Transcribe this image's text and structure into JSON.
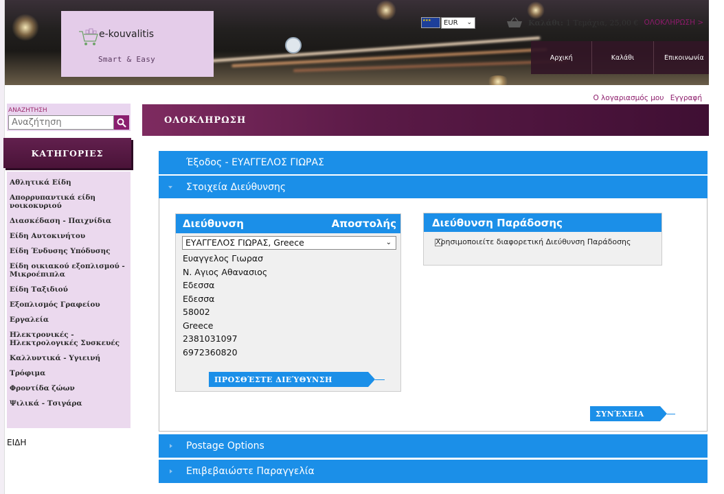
{
  "logo": {
    "name": "e-kouvalitis",
    "tagline": "Smart & Easy"
  },
  "currency": {
    "selected": "EUR"
  },
  "topbar": {
    "cart_label": "Καλάθι:",
    "cart_summary": "1 Τεμάχια, 25,00 €",
    "checkout_link": "ΟΛΟΚΛΗΡΩΣΗ >"
  },
  "topnav": {
    "home": "Αρχική",
    "cart": "Καλάθι",
    "contact": "Επικοινωνία"
  },
  "account": {
    "my_account": "Ο λογαριασμός μου",
    "register": "Εγγραφή"
  },
  "search": {
    "label": "ΑΝΑΖΗΤΗΣΗ",
    "placeholder": "Αναζήτηση"
  },
  "categories": {
    "header": "ΚΑΤΗΓΟΡΙΕΣ",
    "items": [
      "Αθλητικά Είδη",
      "Απορρυπαντικά είδη νοικοκυριού",
      "Διασκέδαση - Παιχνίδια",
      "Είδη Αυτοκινήτου",
      "Είδη Ένδυσης Υπόδυσης",
      "Είδη οικιακού εξοπλισμού - Μικροέπιπλα",
      "Είδη Ταξιδιού",
      "Εξοπλισμός Γραφείου",
      "Εργαλεία",
      "Ηλεκτρονικές - Ηλεκτρολογικές Συσκευές",
      "Καλλυντικά - Υγιεινή",
      "Τρόφιμα",
      "Φροντίδα ζώων",
      "Ψιλικά - Τσιγάρα"
    ],
    "footer_label": "ΕΙΔΗ"
  },
  "main": {
    "title": "ΟΛΟΚΛΗΡΩΣΗ",
    "logout_bar": "Έξοδος - ΕΥΑΓΓΕΛΟΣ ΓΙΩΡΑΣ",
    "address_section": "Στοιχεία Διεύθυνσης",
    "postage_section": "Postage Options",
    "confirm_section": "Επιβεβαιώστε Παραγγελία"
  },
  "shipping": {
    "header_left": "Διεύθυνση",
    "header_right": "Αποστολής",
    "selected_address": "ΕΥΑΓΓΕΛΟΣ ΓΙΩΡΑΣ, Greece",
    "lines": [
      "Ευαγγελος Γιωρασ",
      "Ν. Αγιος Αθανασιος",
      "Εδεσσα",
      "Εδεσσα",
      "58002",
      "Greece",
      "2381031097",
      "6972360820"
    ],
    "add_button": "ΠΡΟΣΘΈΣΤΕ ΔΙΕΎΘΥΝΣΗ"
  },
  "delivery": {
    "header": "Διεύθυνση Παράδοσης",
    "checkbox_label": "Χρησιμοποιείτε διαφορετική Διεύθυνση Παράδοσης"
  },
  "continue_button": "ΣΥΝΈΧΕΙΑ",
  "colors": {
    "accent_blue": "#1b8fe8",
    "brand_purple": "#5b1a47",
    "sidebar_lilac": "#ebd9ee"
  }
}
